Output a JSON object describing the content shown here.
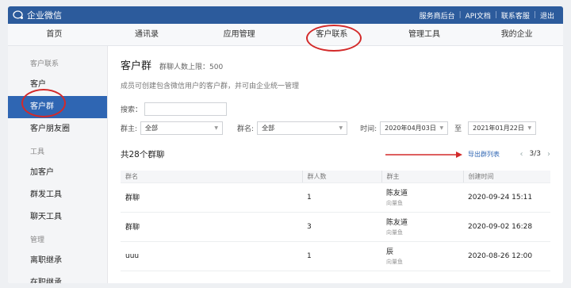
{
  "brand": {
    "name": "企业微信"
  },
  "toplinks": [
    "服务商后台",
    "API文档",
    "联系客服",
    "退出"
  ],
  "nav": {
    "tabs": [
      "首页",
      "通讯录",
      "应用管理",
      "客户联系",
      "管理工具",
      "我的企业"
    ]
  },
  "sidebar": {
    "groups": [
      {
        "title": "客户联系",
        "items": [
          "客户",
          "客户群",
          "客户朋友圈"
        ]
      },
      {
        "title": "工具",
        "items": [
          "加客户",
          "群发工具",
          "聊天工具"
        ]
      },
      {
        "title": "管理",
        "items": [
          "离职继承",
          "在职继承"
        ]
      }
    ],
    "active": "客户群"
  },
  "main": {
    "title": "客户群",
    "subnote": "群聊人数上限：500",
    "description": "成员可创建包含微信用户的客户群，并可由企业统一管理",
    "search_label": "搜索：",
    "search_value": "",
    "owner_label": "群主:",
    "owner_value": "全部",
    "name_label": "群名:",
    "name_value": "全部",
    "time_label": "时间:",
    "date_from": "2020年04月03日",
    "to_label": "至",
    "date_to": "2021年01月22日",
    "count_text": "共28个群聊",
    "export_label": "导出群列表",
    "page": "3/3",
    "columns": [
      "群名",
      "群人数",
      "群主",
      "创建时间"
    ],
    "rows": [
      {
        "name": "群聊",
        "members": "1",
        "owner": "陈友道",
        "org": "向量鱼",
        "created": "2020-09-24 15:11"
      },
      {
        "name": "群聊",
        "members": "3",
        "owner": "陈友道",
        "org": "向量鱼",
        "created": "2020-09-02 16:28"
      },
      {
        "name": "uuu",
        "members": "1",
        "owner": "辰",
        "org": "向量鱼",
        "created": "2020-08-26 12:00"
      }
    ]
  },
  "colors": {
    "topbar": "#2c5b9c",
    "active": "#2f66b3",
    "annotation": "#d32a2a"
  }
}
